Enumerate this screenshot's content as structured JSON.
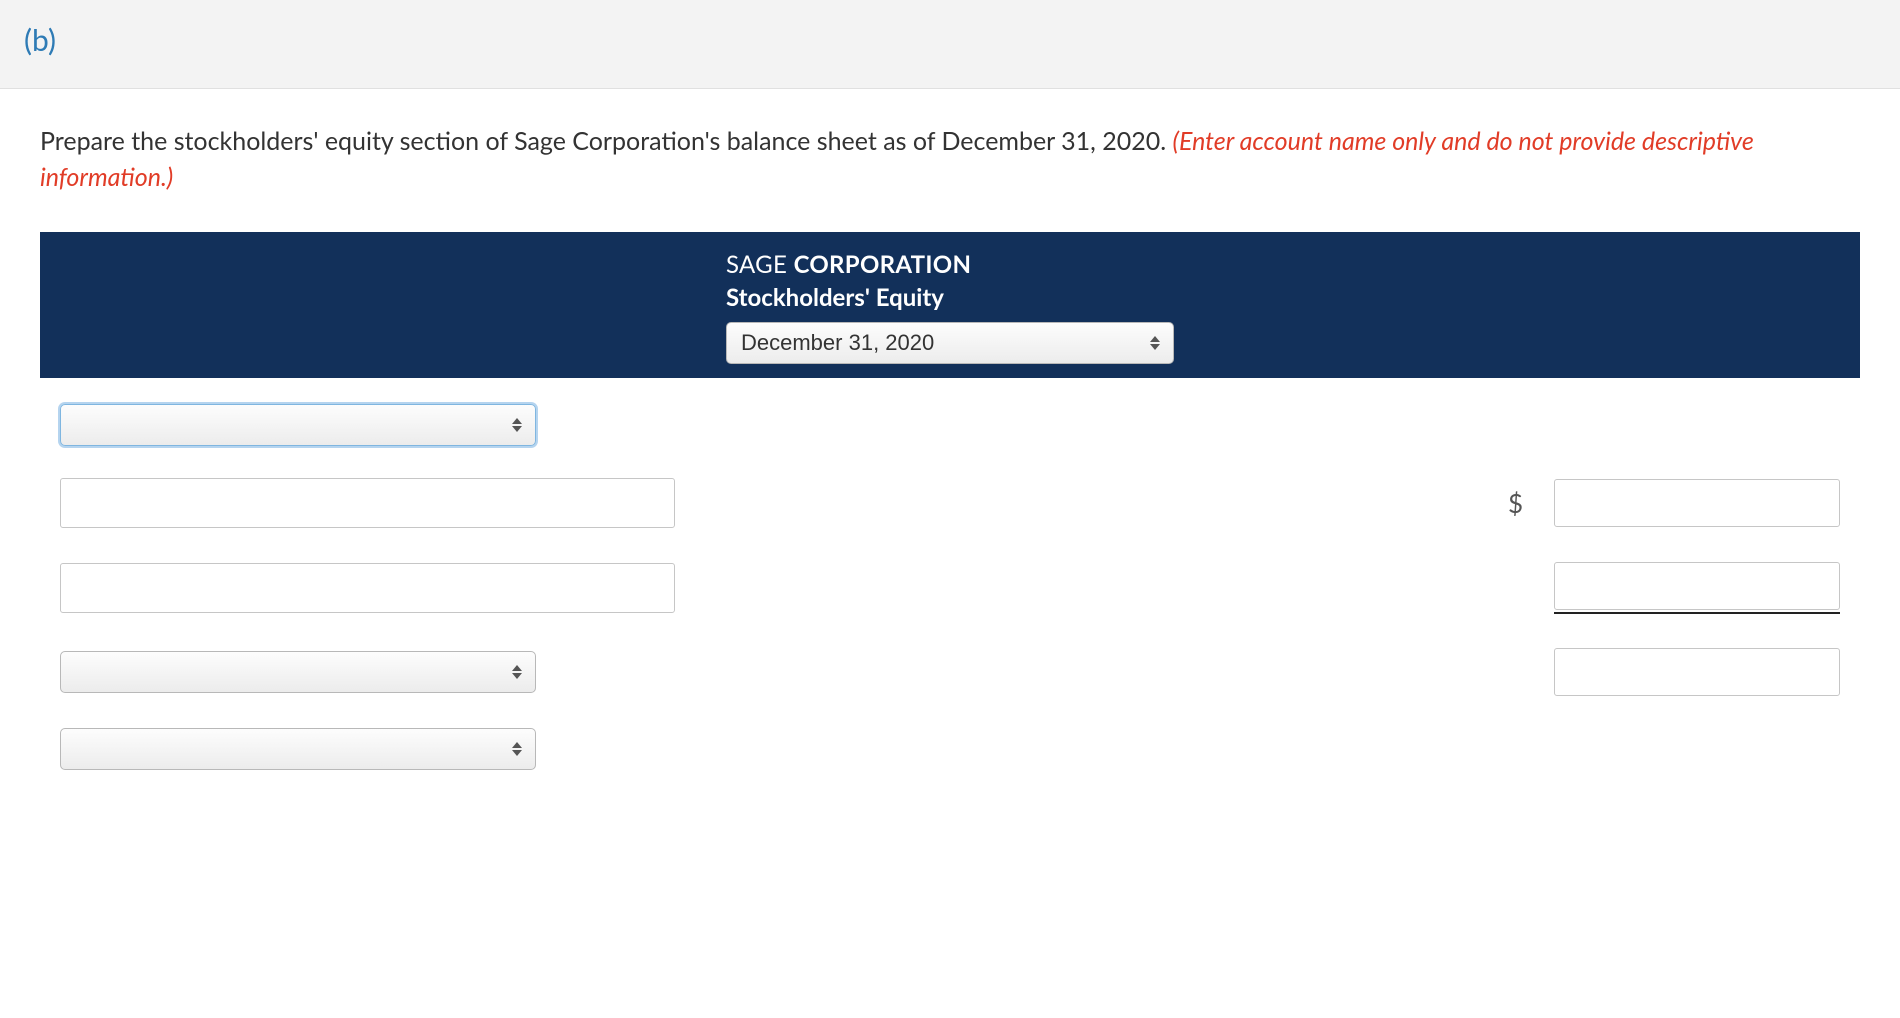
{
  "header": {
    "part_label": "(b)"
  },
  "instruction": {
    "text": "Prepare the stockholders' equity section of Sage Corporation's balance sheet as of December 31, 2020. ",
    "hint": "(Enter account name only and do not provide descriptive information.)"
  },
  "sheet": {
    "company_first": "SAGE ",
    "company_last": "CORPORATION",
    "section_title": "Stockholders' Equity",
    "date_value": "December 31, 2020"
  },
  "rows": {
    "select1_value": "",
    "account1_value": "",
    "amount1_prefix": "$",
    "amount1_value": "",
    "account2_value": "",
    "amount2_value": "",
    "select2_value": "",
    "amount3_value": "",
    "select3_value": ""
  }
}
